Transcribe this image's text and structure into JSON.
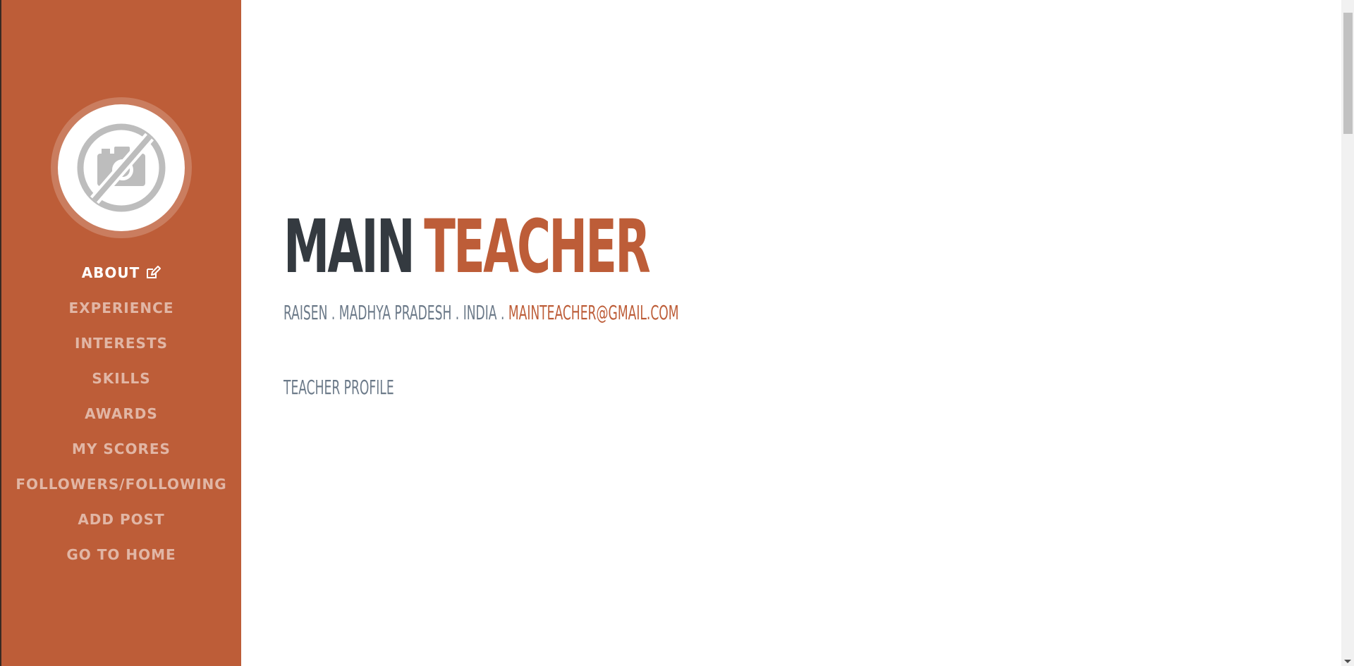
{
  "sidebar": {
    "avatar_alt": "no-photo",
    "nav": [
      {
        "label": "ABOUT",
        "active": true
      },
      {
        "label": "EXPERIENCE"
      },
      {
        "label": "INTERESTS"
      },
      {
        "label": "SKILLS"
      },
      {
        "label": "AWARDS"
      },
      {
        "label": "MY SCORES"
      },
      {
        "label": "FOLLOWERS/FOLLOWING"
      },
      {
        "label": "ADD POST"
      },
      {
        "label": "GO TO HOME"
      }
    ]
  },
  "main": {
    "first_name": "MAIN",
    "last_name": "TEACHER",
    "location": "RAISEN . MADHYA PRADESH . INDIA . ",
    "email": "MAINTEACHER@GMAIL.COM",
    "profile": "TEACHER PROFILE"
  },
  "colors": {
    "primary": "#bd5d38",
    "heading": "#343a40",
    "muted": "#6c7a89"
  },
  "icons": {
    "avatar": "no-camera-icon",
    "edit": "edit-icon"
  }
}
